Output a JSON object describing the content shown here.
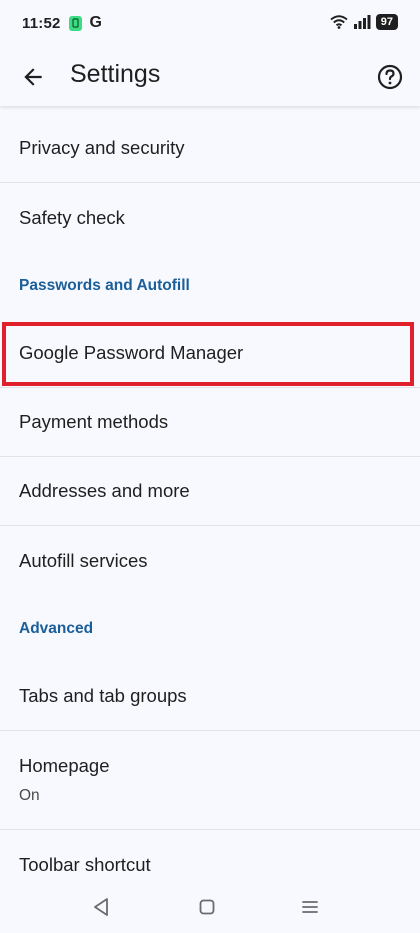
{
  "status_bar": {
    "time": "11:52",
    "app_letter": "G",
    "battery": "97"
  },
  "app_bar": {
    "title": "Settings",
    "back_icon": "arrow-back-icon",
    "help_icon": "help-circle-icon"
  },
  "settings": {
    "privacy": "Privacy and security",
    "safety": "Safety check",
    "passwords_header": "Passwords and Autofill",
    "password_manager": "Google Password Manager",
    "payment": "Payment methods",
    "addresses": "Addresses and more",
    "autofill_services": "Autofill services",
    "advanced_header": "Advanced",
    "tabs": "Tabs and tab groups",
    "homepage": "Homepage",
    "homepage_value": "On",
    "toolbar_shortcut": "Toolbar shortcut"
  },
  "colors": {
    "accent": "#1a5e9a",
    "highlight": "#e0212b",
    "background": "#f8f9fe"
  },
  "nav_bar": {
    "back": "nav-back-icon",
    "home": "nav-home-icon",
    "recents": "nav-menu-icon"
  }
}
